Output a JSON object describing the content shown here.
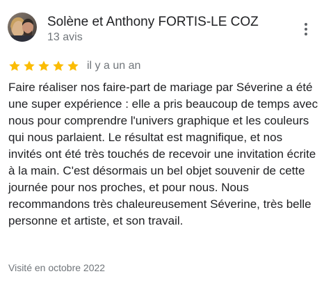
{
  "review": {
    "author_name": "Solène et Anthony FORTIS-LE COZ",
    "author_review_count": "13 avis",
    "rating": 5,
    "rating_max": 5,
    "star_color": "#fbbc04",
    "relative_date": "il y a un an",
    "text": "Faire réaliser nos faire-part de mariage par Séverine a été une super expérience : elle a pris beaucoup de temps avec nous pour comprendre l'univers graphique et les couleurs qui nous parlaient. Le résultat est magnifique, et nos invités ont été très touchés de recevoir une invitation écrite à la main. C'est désormais un bel objet souvenir de cette journée pour nos proches, et pour nous. Nous recommandons très chaleureusement Séverine, très belle personne et artiste, et son travail.",
    "visited": "Visité en octobre 2022",
    "more_icon": "more-vert-icon"
  }
}
